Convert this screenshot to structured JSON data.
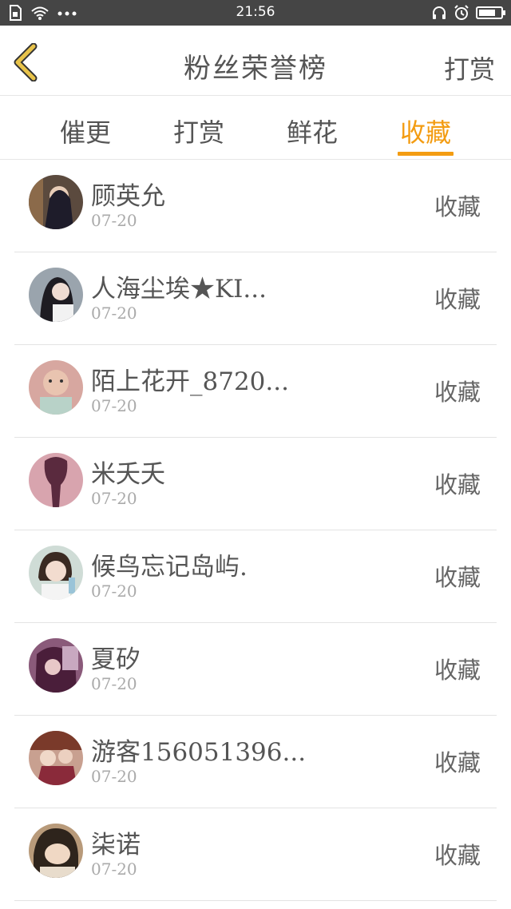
{
  "status_bar": {
    "time": "21:56",
    "left_icons": [
      "sim-icon",
      "wifi-icon",
      "more-dots-icon"
    ],
    "right_icons": [
      "headset-icon",
      "alarm-icon",
      "battery-icon"
    ],
    "battery_level": 0.6
  },
  "header": {
    "title": "粉丝荣誉榜",
    "right_action": "打赏"
  },
  "tabs": [
    {
      "label": "催更",
      "active": false
    },
    {
      "label": "打赏",
      "active": false
    },
    {
      "label": "鲜花",
      "active": false
    },
    {
      "label": "收藏",
      "active": true
    }
  ],
  "colors": {
    "accent": "#f39c12",
    "status_bar": "#454545",
    "back_arrow": "#e8c34a"
  },
  "list": [
    {
      "name": "顾英允",
      "date": "07-20",
      "action": "收藏",
      "avatar_color": "#3b3238"
    },
    {
      "name": "人海尘埃★KI...",
      "date": "07-20",
      "action": "收藏",
      "avatar_color": "#6a7078"
    },
    {
      "name": "陌上花开_8720...",
      "date": "07-20",
      "action": "收藏",
      "avatar_color": "#c99a8e"
    },
    {
      "name": "米夭夭",
      "date": "07-20",
      "action": "收藏",
      "avatar_color": "#b87a86"
    },
    {
      "name": "候鸟忘记岛屿.",
      "date": "07-20",
      "action": "收藏",
      "avatar_color": "#a7b9b5"
    },
    {
      "name": "夏矽",
      "date": "07-20",
      "action": "收藏",
      "avatar_color": "#7a3a5a"
    },
    {
      "name": "游客156051396...",
      "date": "07-20",
      "action": "收藏",
      "avatar_color": "#9a6a5a"
    },
    {
      "name": "柒诺",
      "date": "07-20",
      "action": "收藏",
      "avatar_color": "#6b5a48"
    }
  ]
}
